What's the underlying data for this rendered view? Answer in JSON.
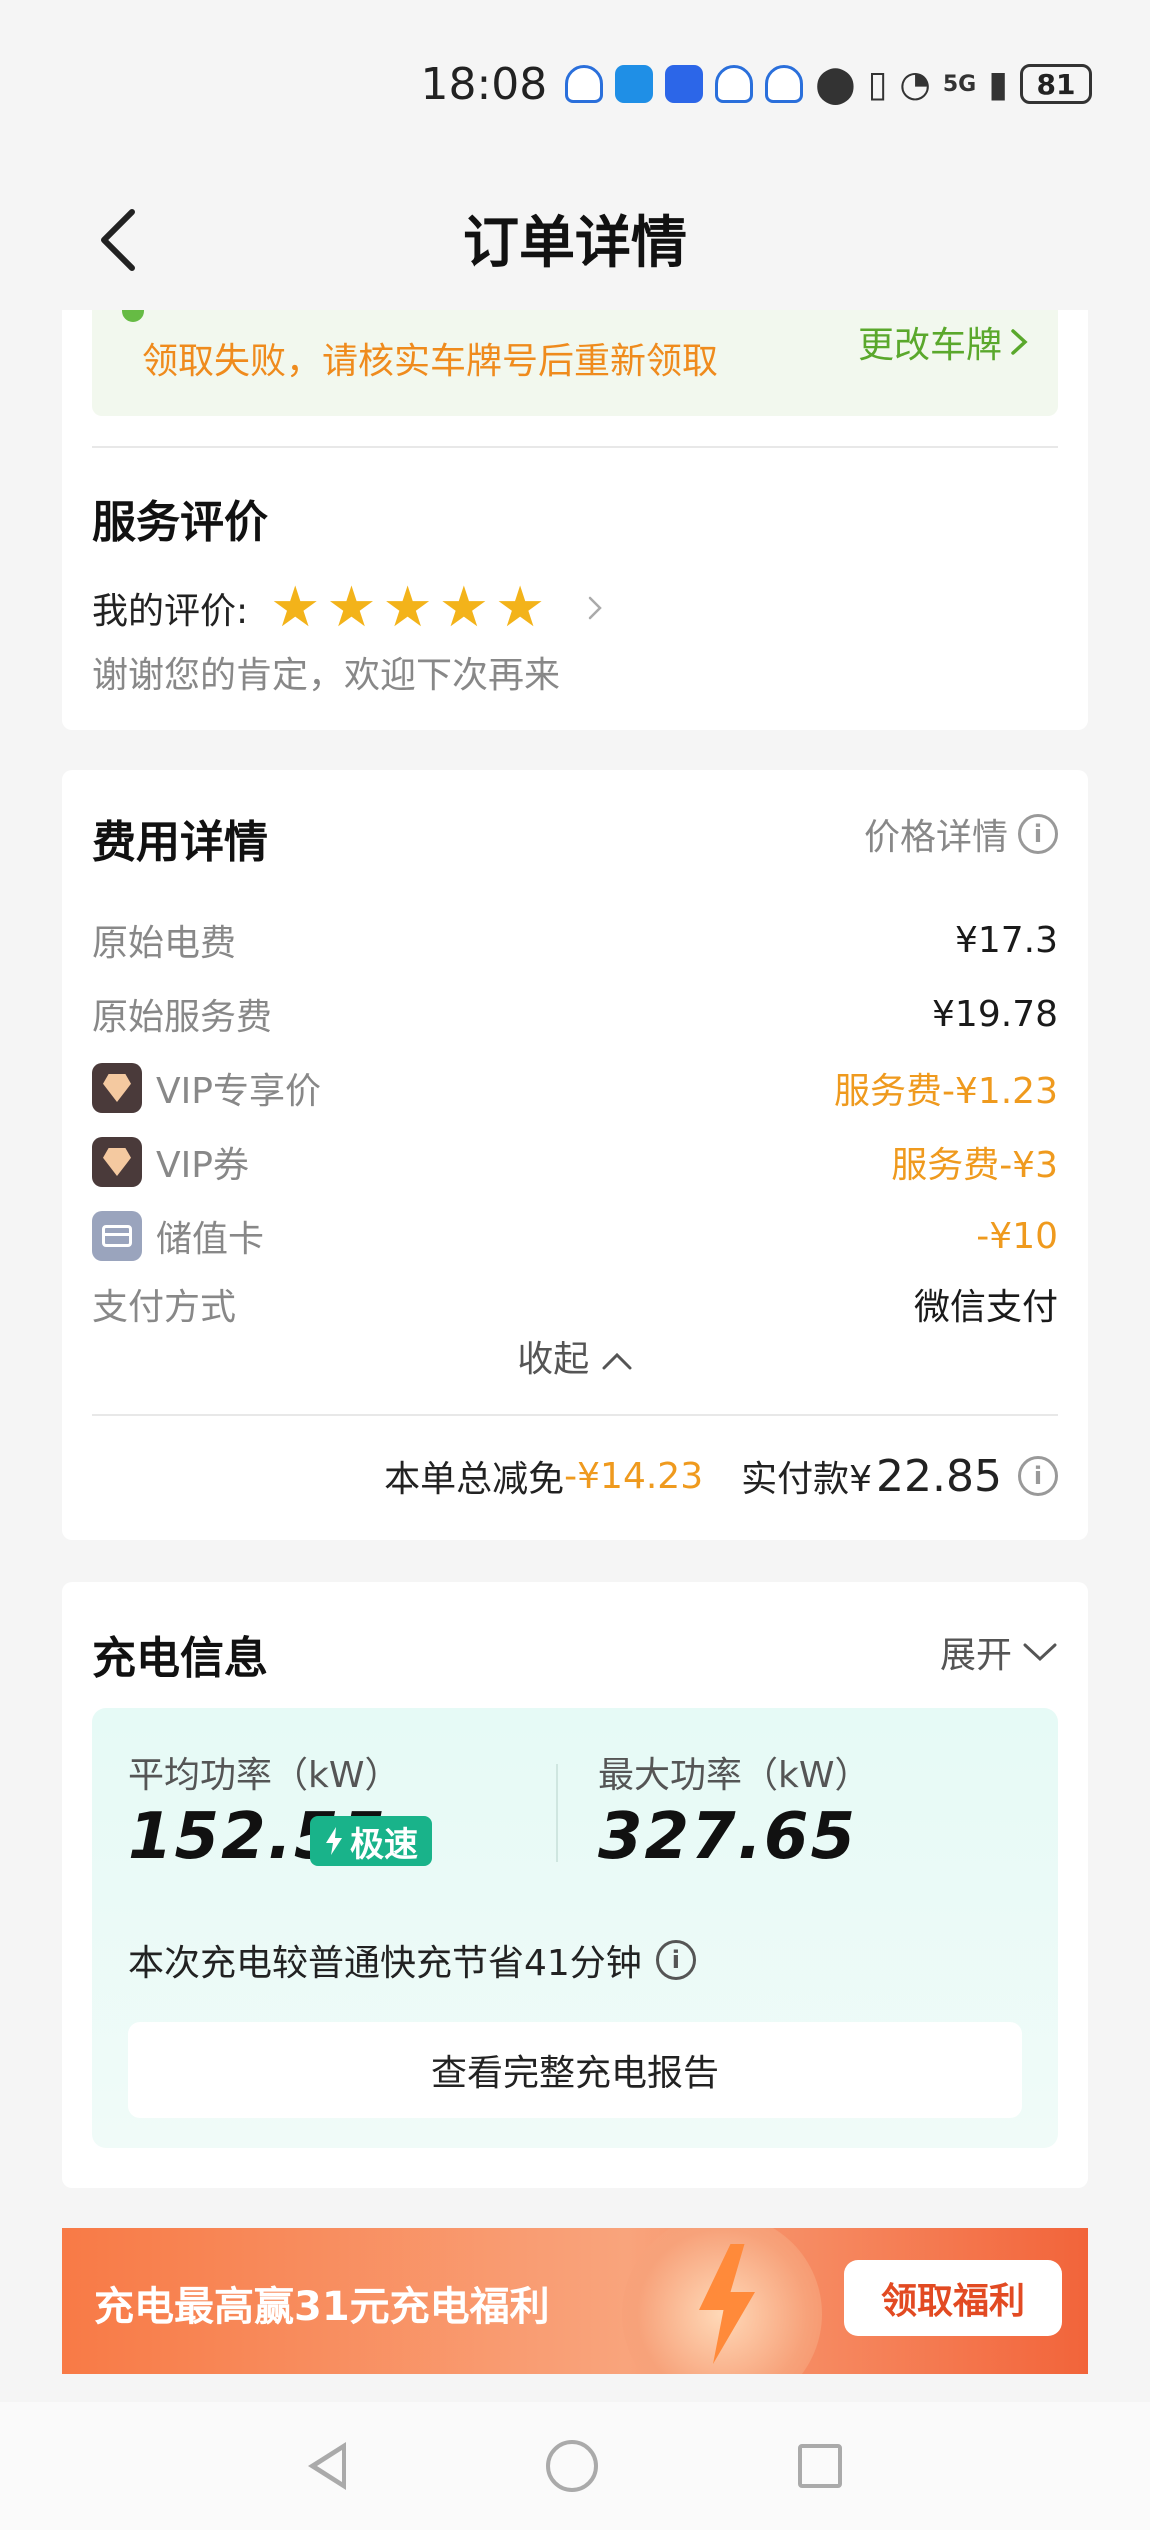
{
  "status_bar": {
    "time": "18:08",
    "network": "5G",
    "battery": "81"
  },
  "header": {
    "title": "订单详情",
    "back_icon": "chevron-left-icon"
  },
  "notice": {
    "message": "领取失败，请核实车牌号后重新领取",
    "change_plate_label": "更改车牌"
  },
  "rating": {
    "title": "服务评价",
    "label": "我的评价:",
    "stars": 5,
    "star_glyph": "★",
    "comment": "谢谢您的肯定，欢迎下次再来"
  },
  "fees": {
    "title": "费用详情",
    "price_detail_label": "价格详情",
    "rows": [
      {
        "label": "原始电费",
        "value": "¥17.3",
        "icon": ""
      },
      {
        "label": "原始服务费",
        "value": "¥19.78",
        "icon": ""
      },
      {
        "label": "VIP专享价",
        "value": "服务费-¥1.23",
        "icon": "vip-diamond-icon"
      },
      {
        "label": "VIP券",
        "value": "服务费-¥3",
        "icon": "vip-diamond-icon"
      },
      {
        "label": "储值卡",
        "value": "-¥10",
        "icon": "stored-value-card-icon"
      },
      {
        "label": "支付方式",
        "value": "微信支付",
        "icon": ""
      }
    ],
    "collapse_label": "收起",
    "total_discount_label": "本单总减免",
    "total_discount_value": "-¥14.23",
    "paid_label": "实付款¥",
    "paid_value": "22.85"
  },
  "charging": {
    "title": "充电信息",
    "expand_label": "展开",
    "avg_power_label": "平均功率（kW）",
    "avg_power_value": "152.55",
    "speed_badge": "极速",
    "max_power_label": "最大功率（kW）",
    "max_power_value": "327.65",
    "saving_text": "本次充电较普通快充节省41分钟",
    "report_button": "查看完整充电报告"
  },
  "promo": {
    "text": "充电最高赢31元充电福利",
    "button": "领取福利"
  },
  "colors": {
    "accent_orange": "#ef9a1e",
    "accent_green": "#5aa82c",
    "speed_green": "#19b38a",
    "promo_red": "#e24a22"
  }
}
